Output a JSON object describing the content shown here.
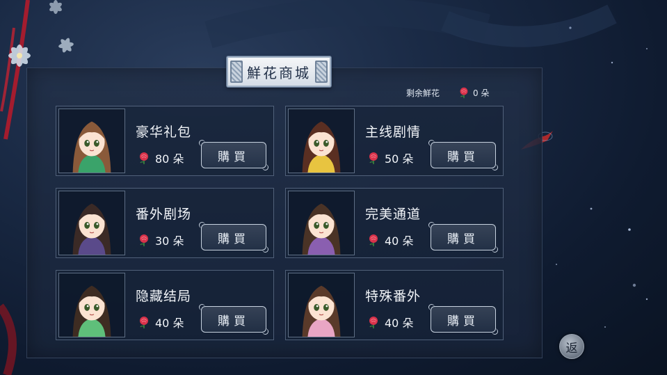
{
  "shop": {
    "title": "鮮花商城",
    "remaining_label": "剩余鮮花",
    "remaining_value": "0 朵"
  },
  "items": [
    {
      "name": "豪华礼包",
      "price": "80 朵",
      "buy_label": "購買",
      "hair": "#8a5a3a",
      "outfit": "#3aa36a"
    },
    {
      "name": "主线剧情",
      "price": "50 朵",
      "buy_label": "購買",
      "hair": "#5a2f22",
      "outfit": "#e8c440"
    },
    {
      "name": "番外剧场",
      "price": "30 朵",
      "buy_label": "購買",
      "hair": "#3b2a26",
      "outfit": "#5a4a8a"
    },
    {
      "name": "完美通道",
      "price": "40 朵",
      "buy_label": "購買",
      "hair": "#4a3326",
      "outfit": "#8a5fb0"
    },
    {
      "name": "隐藏结局",
      "price": "40 朵",
      "buy_label": "購買",
      "hair": "#3e2c22",
      "outfit": "#5fbf7a"
    },
    {
      "name": "特殊番外",
      "price": "40 朵",
      "buy_label": "購買",
      "hair": "#5a3a2a",
      "outfit": "#e9a6c4"
    }
  ],
  "back_label": "返",
  "icons": {
    "currency": "rose-icon",
    "back": "back-icon"
  },
  "colors": {
    "rose": "#d8324a",
    "panel": "#1f2e48",
    "title_plate": "#e9eef3"
  }
}
